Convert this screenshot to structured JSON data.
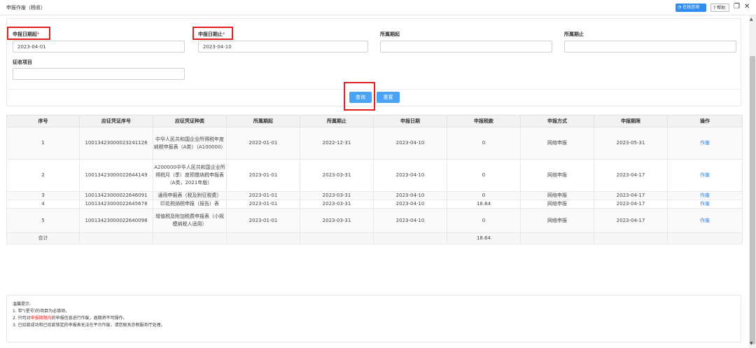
{
  "window": {
    "title": "申报作废（税收）",
    "online_consult": "在线咨询",
    "help": "? 帮助"
  },
  "form": {
    "start_label": "申报日期起",
    "end_label": "申报日期止",
    "required_mark": "*",
    "start_value": "2023-04-01",
    "end_value": "2023-04-10",
    "period_start_label": "所属期起",
    "period_end_label": "所属期止",
    "levy_item_label": "征收项目",
    "period_start_value": "",
    "period_end_value": "",
    "levy_item_value": ""
  },
  "buttons": {
    "query": "查询",
    "reset": "重置"
  },
  "table": {
    "headers": [
      "序号",
      "应征凭证序号",
      "应征凭证种类",
      "所属期起",
      "所属期止",
      "申报日期",
      "申报税款",
      "申报方式",
      "申报期限",
      "操作"
    ],
    "rows": [
      [
        "1",
        "10013423000023241126",
        "中华人民共和国企业所得税年度纳税申报表（A类）（A100000）",
        "2022-01-01",
        "2022-12-31",
        "2023-04-10",
        "0",
        "网络申报",
        "2023-05-31",
        "作废"
      ],
      [
        "2",
        "10013423000022644149",
        "A200000中华人民共和国企业所得税月（季）度预缴纳税申报表（A类，2021年版）",
        "2023-01-01",
        "2023-03-31",
        "2023-04-10",
        "0",
        "网络申报",
        "2023-04-17",
        "作废"
      ],
      [
        "3",
        "10013423000022646091",
        "通用申报表（税及附征税费）",
        "2023-01-01",
        "2023-03-31",
        "2023-04-10",
        "0",
        "网络申报",
        "2023-04-17",
        "作废"
      ],
      [
        "4",
        "10013423000022645678",
        "印花税纳税申报（报告）表",
        "2023-01-01",
        "2023-03-31",
        "2023-04-10",
        "18.64",
        "网络申报",
        "2023-04-17",
        "作废"
      ],
      [
        "5",
        "10013423000022640098",
        "增值税及附加税费申报表（小规模纳税人适用）",
        "2023-01-01",
        "2023-03-31",
        "2023-04-10",
        "0",
        "网络申报",
        "2023-04-17",
        "作废"
      ]
    ],
    "total_label": "合计",
    "total_tax": "18.64"
  },
  "tips": {
    "title": "温馨提示:",
    "line1": "1. 带\"(星号)的项目为必填项。",
    "line2_pre": "2. 只可对",
    "line2_hl": "申报期限内",
    "line2_post": "的申报信息进行作废，逾期将不可操作。",
    "line3": "3. 已扣款成功和已扣款锁定的申报表无法在平台作废，请您联系办税服务厅处理。"
  },
  "colors": {
    "accent": "#4aa3f5",
    "highlight": "#e02020",
    "link": "#2f7de1"
  }
}
